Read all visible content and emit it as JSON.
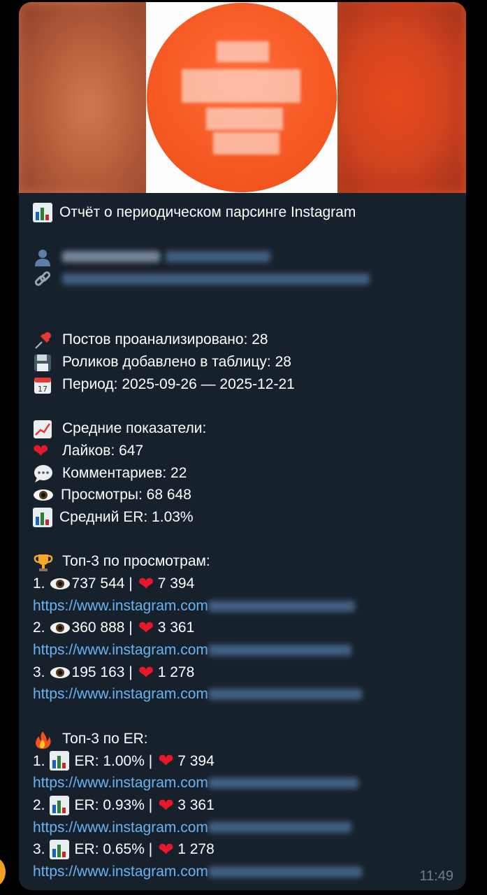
{
  "preview": {
    "alt": "blurred channel avatar"
  },
  "report": {
    "title": "Отчёт о периодическом парсинге Instagram",
    "posts_analyzed": "Постов проанализировано: 28",
    "reels_added": "Роликов добавлено в таблицу: 28",
    "period": "Период: 2025-09-26 — 2025-12-21",
    "avg_header": "Средние показатели:",
    "likes": "Лайков: 647",
    "comments": "Комментариев: 22",
    "views": "Просмотры: 68 648",
    "er": "Средний ER: 1.03%"
  },
  "top_views": {
    "header": "Топ-3 по просмотрам:",
    "items": [
      {
        "num": "1.",
        "views": "737 544 |",
        "likes": "7 394",
        "link": "https://www.instagram.com"
      },
      {
        "num": "2.",
        "views": "360 888 |",
        "likes": "3 361",
        "link": "https://www.instagram.com"
      },
      {
        "num": "3.",
        "views": "195 163 |",
        "likes": "1 278",
        "link": "https://www.instagram.com"
      }
    ]
  },
  "top_er": {
    "header": "Топ-3 по ER:",
    "items": [
      {
        "num": "1.",
        "er": "ER: 1.00% |",
        "likes": "7 394",
        "link": "https://www.instagram.com"
      },
      {
        "num": "2.",
        "er": "ER: 0.93% |",
        "likes": "3 361",
        "link": "https://www.instagram.com"
      },
      {
        "num": "3.",
        "er": "ER: 0.65% |",
        "likes": "1 278",
        "link": "https://www.instagram.com"
      }
    ]
  },
  "time": "11:49",
  "colors": {
    "bubble": "#17212b",
    "link": "#6ab3f3",
    "heart": "#e8172c"
  }
}
